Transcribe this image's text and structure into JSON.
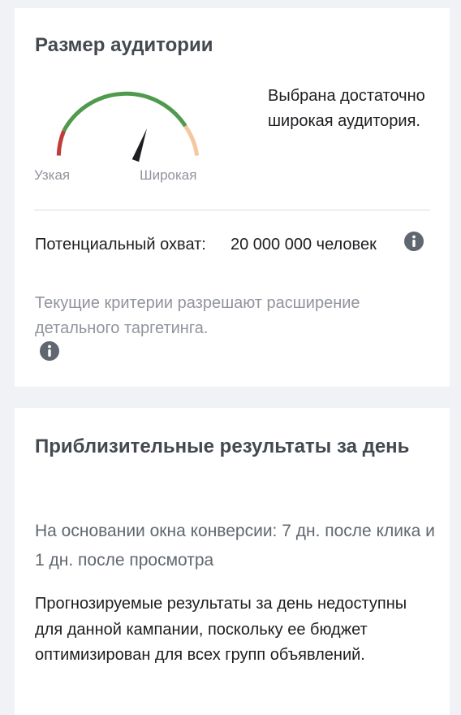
{
  "audience_size": {
    "title": "Размер аудитории",
    "gauge": {
      "level": 0.64,
      "label_narrow": "Узкая",
      "label_wide": "Широкая",
      "colors": {
        "narrow": "#c23b3b",
        "ok": "#4f9a4c",
        "wide": "#f5c7a0",
        "needle": "#1c1e21"
      }
    },
    "description": "Выбрана достаточно широкая аудитория.",
    "reach_label": "Потенциальный охват:",
    "reach_value": "20 000 000 человек",
    "info_icon": "info-icon",
    "criteria_text": "Текущие критерии разрешают расширение детального таргетинга."
  },
  "daily_results": {
    "title": "Приблизительные результаты за день",
    "conversion_text": "На основании окна конверсии: 7 дн. после клика и 1 дн. после просмотра",
    "forecast_text": "Прогнозируемые результаты за день недоступны для данной кампании, поскольку ее бюджет оптимизирован для всех групп объявлений."
  }
}
